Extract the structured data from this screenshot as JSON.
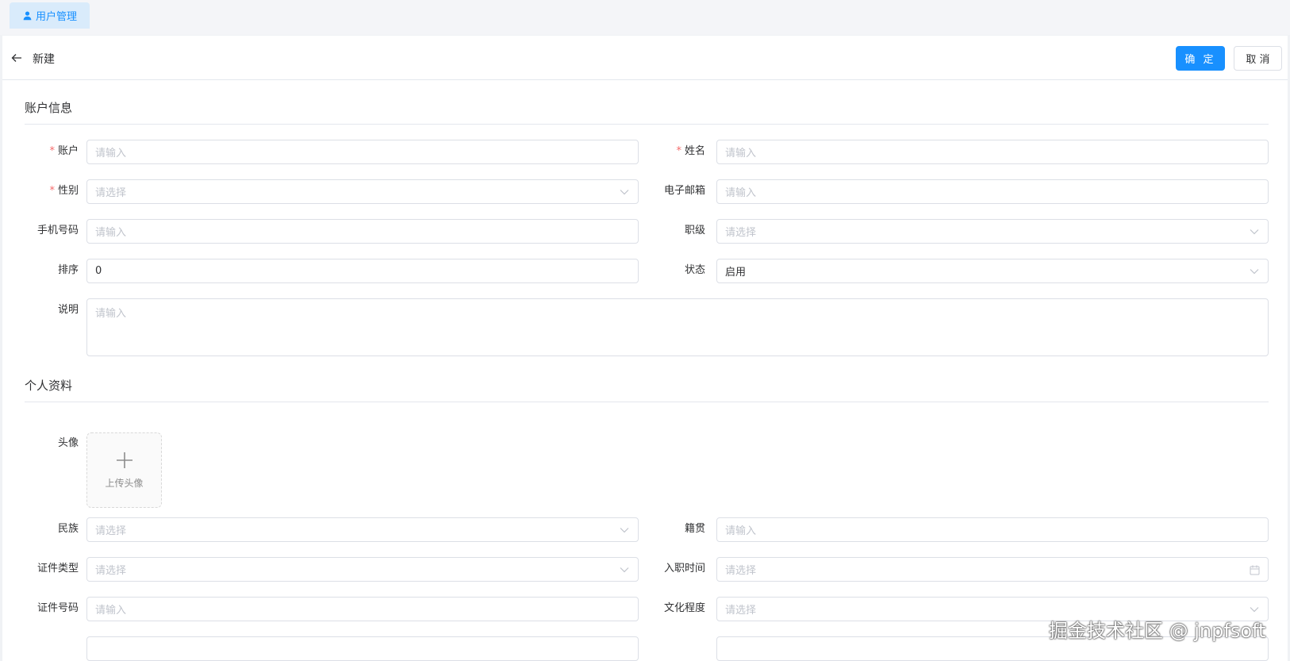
{
  "tab": {
    "label": "用户管理",
    "icon": "user-icon"
  },
  "header": {
    "title": "新建",
    "confirm_label": "确 定",
    "cancel_label": "取 消"
  },
  "account_section": {
    "title": "账户信息",
    "fields": {
      "account": {
        "label": "账户",
        "required": true,
        "placeholder": "请输入"
      },
      "name": {
        "label": "姓名",
        "required": true,
        "placeholder": "请输入"
      },
      "gender": {
        "label": "性别",
        "required": true,
        "placeholder": "请选择"
      },
      "email": {
        "label": "电子邮箱",
        "placeholder": "请输入"
      },
      "phone": {
        "label": "手机号码",
        "placeholder": "请输入"
      },
      "rank": {
        "label": "职级",
        "placeholder": "请选择"
      },
      "sort": {
        "label": "排序",
        "value": "0"
      },
      "status": {
        "label": "状态",
        "value": "启用"
      },
      "description": {
        "label": "说明",
        "placeholder": "请输入"
      }
    }
  },
  "profile_section": {
    "title": "个人资料",
    "avatar": {
      "label": "头像",
      "upload_text": "上传头像"
    },
    "fields": {
      "ethnicity": {
        "label": "民族",
        "placeholder": "请选择"
      },
      "native_place": {
        "label": "籍贯",
        "placeholder": "请输入"
      },
      "id_type": {
        "label": "证件类型",
        "placeholder": "请选择"
      },
      "hire_date": {
        "label": "入职时间",
        "placeholder": "请选择"
      },
      "id_number": {
        "label": "证件号码",
        "placeholder": "请输入"
      },
      "education": {
        "label": "文化程度",
        "placeholder": "请选择"
      }
    }
  },
  "watermark": "掘金技术社区 @ jnpfsoft",
  "colors": {
    "primary": "#1890ff",
    "required": "#f56c6c",
    "border": "#dcdfe6",
    "placeholder": "#c0c4cc"
  }
}
